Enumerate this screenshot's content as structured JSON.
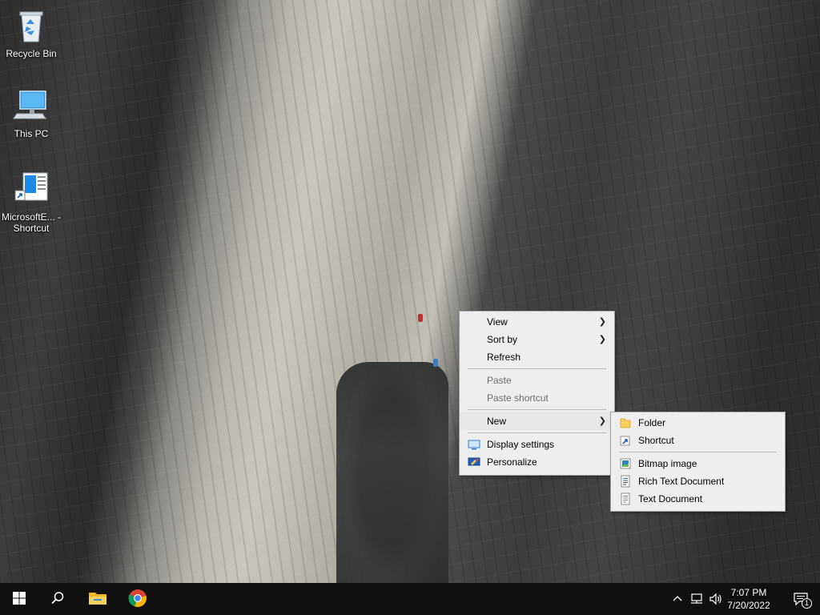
{
  "desktop": {
    "icons": [
      {
        "label": "Recycle Bin",
        "icon": "recycle-bin-icon"
      },
      {
        "label": "This PC",
        "icon": "this-pc-icon"
      },
      {
        "label": "MicrosoftE... - Shortcut",
        "icon": "shortcut-icon"
      }
    ]
  },
  "context_menu": {
    "items": [
      {
        "label": "View",
        "has_submenu": true,
        "disabled": false
      },
      {
        "label": "Sort by",
        "has_submenu": true,
        "disabled": false
      },
      {
        "label": "Refresh",
        "has_submenu": false,
        "disabled": false
      },
      {
        "label": "Paste",
        "has_submenu": false,
        "disabled": true
      },
      {
        "label": "Paste shortcut",
        "has_submenu": false,
        "disabled": true
      },
      {
        "label": "New",
        "has_submenu": true,
        "disabled": false
      },
      {
        "label": "Display settings",
        "icon": "display-icon",
        "disabled": false
      },
      {
        "label": "Personalize",
        "icon": "personalize-icon",
        "disabled": false
      }
    ]
  },
  "new_submenu": {
    "items": [
      {
        "label": "Folder",
        "icon": "folder-icon"
      },
      {
        "label": "Shortcut",
        "icon": "shortcut-icon"
      },
      {
        "label": "Bitmap image",
        "icon": "bitmap-icon"
      },
      {
        "label": "Rich Text Document",
        "icon": "rich-text-icon"
      },
      {
        "label": "Text Document",
        "icon": "text-document-icon"
      }
    ]
  },
  "taskbar": {
    "start": "windows-start-icon",
    "search": "search-icon",
    "pinned": [
      "file-explorer-icon",
      "chrome-icon"
    ],
    "tray": {
      "time": "7:07 PM",
      "date": "7/20/2022",
      "notification_count": "1"
    }
  },
  "colors": {
    "taskbar": "#101010",
    "menu_bg": "#eeeeee",
    "disabled_text": "#6d6d6d"
  }
}
